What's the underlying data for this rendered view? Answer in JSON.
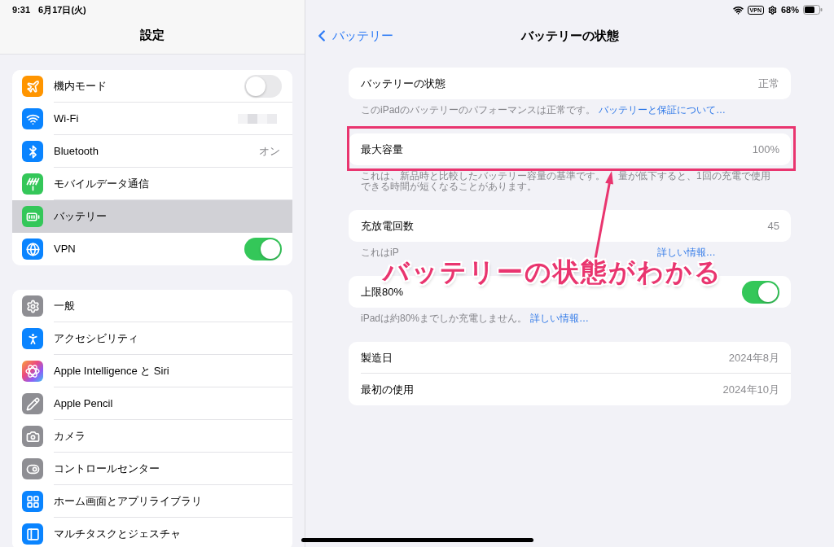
{
  "status_bar": {
    "time": "9:31",
    "date": "6月17日(火)",
    "vpn": "VPN",
    "battery": "68%"
  },
  "sidebar": {
    "title": "設定",
    "groups": [
      {
        "items": [
          {
            "label": "機内モード",
            "kind": "toggle",
            "on": false,
            "selected": false
          },
          {
            "label": "Wi-Fi",
            "kind": "redacted",
            "selected": false
          },
          {
            "label": "Bluetooth",
            "kind": "value",
            "value": "オン",
            "selected": false
          },
          {
            "label": "モバイルデータ通信",
            "kind": "plain",
            "selected": false
          },
          {
            "label": "バッテリー",
            "kind": "plain",
            "selected": true
          },
          {
            "label": "VPN",
            "kind": "toggle",
            "on": true,
            "selected": false
          }
        ]
      },
      {
        "items": [
          {
            "label": "一般",
            "kind": "plain",
            "selected": false
          },
          {
            "label": "アクセシビリティ",
            "kind": "plain",
            "selected": false
          },
          {
            "label": "Apple Intelligence と Siri",
            "kind": "plain",
            "selected": false
          },
          {
            "label": "Apple Pencil",
            "kind": "plain",
            "selected": false
          },
          {
            "label": "カメラ",
            "kind": "plain",
            "selected": false
          },
          {
            "label": "コントロールセンター",
            "kind": "plain",
            "selected": false
          },
          {
            "label": "ホーム画面とアプリライブラリ",
            "kind": "plain",
            "selected": false
          },
          {
            "label": "マルチタスクとジェスチャ",
            "kind": "plain",
            "selected": false
          }
        ]
      }
    ]
  },
  "detail": {
    "back": "バッテリー",
    "title": "バッテリーの状態",
    "sections": [
      {
        "highlighted": false,
        "rows": [
          {
            "label": "バッテリーの状態",
            "kind": "value",
            "value": "正常"
          }
        ],
        "footer": {
          "kind": "plain",
          "text": "このiPadのバッテリーのパフォーマンスは正常です。",
          "link": "バッテリーと保証について…"
        }
      },
      {
        "highlighted": true,
        "rows": [
          {
            "label": "最大容量",
            "kind": "value",
            "value": "100%"
          }
        ],
        "footer": {
          "kind": "pierced",
          "parts": [
            "これは、新品時と比較したバッテリー容量の基準です。",
            "量が低下すると、1回の充電で使用できる時間が短くなることがあります。"
          ]
        }
      },
      {
        "highlighted": false,
        "rows": [
          {
            "label": "充放電回数",
            "kind": "value",
            "value": "45"
          }
        ],
        "footer": {
          "kind": "covered",
          "text": "これはiP",
          "link": "詳しい情報…"
        }
      },
      {
        "highlighted": false,
        "rows": [
          {
            "label": "上限80%",
            "kind": "toggle",
            "on": true
          }
        ],
        "footer": {
          "kind": "plain",
          "text": "iPadは約80%までしか充電しません。",
          "link": "詳しい情報…"
        }
      },
      {
        "highlighted": false,
        "rows": [
          {
            "label": "製造日",
            "kind": "value",
            "value": "2024年8月"
          },
          {
            "label": "最初の使用",
            "kind": "value",
            "value": "2024年10月"
          }
        ]
      }
    ]
  },
  "annotation": {
    "caption": "バッテリーの状態がわかる"
  }
}
